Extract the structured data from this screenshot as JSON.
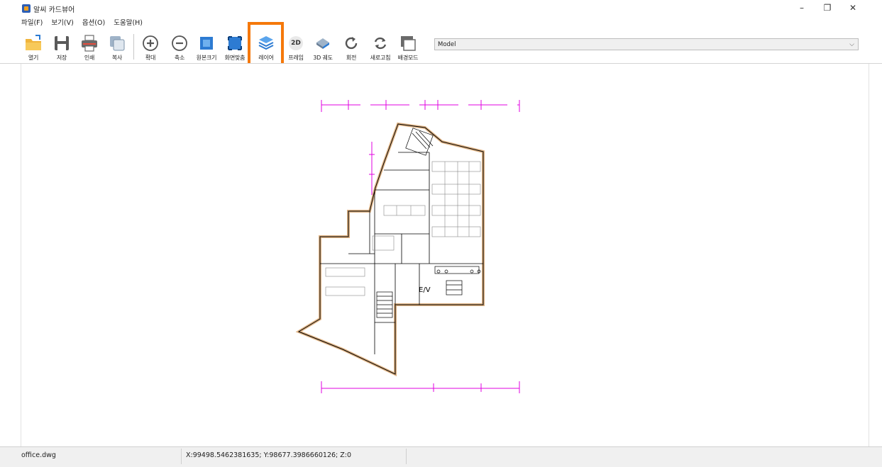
{
  "window": {
    "title": "알씨 카드뷰어",
    "minimize": "–",
    "restore": "❐",
    "close": "✕"
  },
  "menu": [
    "파일(F)",
    "보기(V)",
    "옵션(O)",
    "도움말(H)"
  ],
  "toolbar": {
    "open": "열기",
    "save": "저장",
    "print": "인쇄",
    "copy": "복사",
    "zoom_in": "확대",
    "zoom_out": "축소",
    "original_size": "원본크기",
    "fit_screen": "화면맞춤",
    "layer": "레이어",
    "frame_2d": "프레임",
    "frame_2d_badge": "2D",
    "orbit_3d": "3D 궤도",
    "rotate": "회전",
    "refresh": "새로고침",
    "background_mode": "배경모드",
    "model_select": "Model"
  },
  "status": {
    "file": "office.dwg",
    "coordinates": "X:99498.5462381635; Y:98677.3986660126; Z:0"
  },
  "drawing": {
    "elevator_label": "E/V",
    "wall_color": "#e0b485",
    "dimension_color": "#e000e0",
    "line_color": "#000000"
  },
  "colors": {
    "highlight": "#f5780a",
    "folder": "#f0b43c",
    "icon_blue": "#2d7bd2",
    "icon_gray": "#5a5a5a"
  }
}
